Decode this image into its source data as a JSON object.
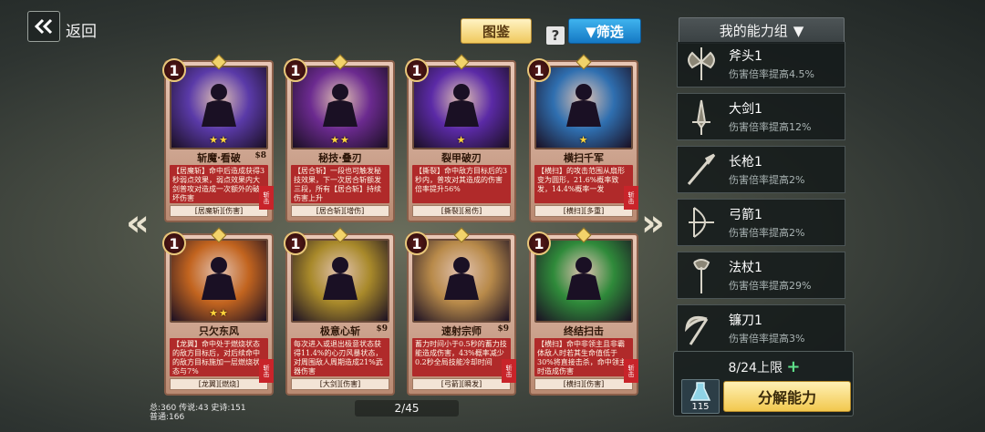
{
  "header": {
    "back_label": "返回",
    "tujian_label": "图鉴",
    "help_symbol": "?",
    "filter_label": "▼筛选",
    "panel_title": "我的能力组",
    "panel_arrow": "▼"
  },
  "nav": {
    "prev_arrow": "«",
    "next_arrow": "»"
  },
  "cards": [
    {
      "cost": "1",
      "stars": "★★",
      "name": "斩魔·看破",
      "price": "$8",
      "desc": "【居魔斩】命中后造成获得3秒弱点效果，弱点效果内大剑普攻对造成一次额外的破坏伤害",
      "tags": "[居魔斩][伤害]",
      "ribbon": "斩击",
      "art_color": "#5a3aa8"
    },
    {
      "cost": "1",
      "stars": "★★",
      "name": "秘技·叠刃",
      "price": "",
      "desc": "【居合斩】一段也可触发秘技效果，下一次居合斩额发三段，所有【居合斩】持续伤害上升",
      "tags": "[居合斩][增伤]",
      "ribbon": "",
      "art_color": "#6b2a8f"
    },
    {
      "cost": "1",
      "stars": "★",
      "name": "裂甲破刃",
      "price": "",
      "desc": "【撕裂】命中敌方目标后的3秒内，普攻对其造成的伤害倍率提升56%",
      "tags": "[撕裂][易伤]",
      "ribbon": "",
      "art_color": "#5b2aa6"
    },
    {
      "cost": "1",
      "stars": "★",
      "name": "横扫千军",
      "price": "",
      "desc": "【横扫】的攻击范围从扇形变为圆形，21.6%概率致发，14.4%概率一发",
      "tags": "[横扫][多重]",
      "ribbon": "斩击",
      "art_color": "#2f6fb0"
    },
    {
      "cost": "1",
      "stars": "★★",
      "name": "只欠东风",
      "price": "",
      "desc": "【龙翼】命中处于燃烧状态的敌方目标后，对后续命中的敌方目标施加一层燃烧状态与7%",
      "tags": "[龙翼][燃烧]",
      "ribbon": "斩击",
      "art_color": "#c2641f"
    },
    {
      "cost": "1",
      "stars": "",
      "name": "极意心斩",
      "price": "$9",
      "desc": "每次进入或退出极意状态获得11.4%的心刃风暴状态，对周围敌人周期造成21%武器伤害",
      "tags": "[大剑][伤害]",
      "ribbon": "",
      "art_color": "#a8892a"
    },
    {
      "cost": "1",
      "stars": "",
      "name": "速射宗师",
      "price": "$9",
      "desc": "蓄力时间小于0.5秒的蓄力技能造成伤害，43%概率减少0.2秒全局技能冷却时间",
      "tags": "[弓箭][瞬发]",
      "ribbon": "斩击",
      "art_color": "#b88a4a"
    },
    {
      "cost": "1",
      "stars": "",
      "name": "终结扫击",
      "price": "",
      "desc": "【横扫】命中非领主且非霸体敌人时若其生命值低于30%将直接击杀，命中领主时造成伤害",
      "tags": "[横扫][伤害]",
      "ribbon": "斩击",
      "art_color": "#2f8a3a"
    }
  ],
  "abilities": [
    {
      "name": "斧头1",
      "effect": "伤害倍率提高4.5%",
      "icon": "axe-icon"
    },
    {
      "name": "大剑1",
      "effect": "伤害倍率提高12%",
      "icon": "greatsword-icon"
    },
    {
      "name": "长枪1",
      "effect": "伤害倍率提高2%",
      "icon": "spear-icon"
    },
    {
      "name": "弓箭1",
      "effect": "伤害倍率提高2%",
      "icon": "bow-icon"
    },
    {
      "name": "法杖1",
      "effect": "伤害倍率提高29%",
      "icon": "staff-icon"
    },
    {
      "name": "镰刀1",
      "effect": "伤害倍率提高3%",
      "icon": "scythe-icon"
    }
  ],
  "limit": {
    "text": "8/24上限",
    "plus": "+",
    "potion_count": "115",
    "decompose_label": "分解能力"
  },
  "stats": {
    "line1": "总:360 传说:43 史诗:151",
    "line2": "普通:166"
  },
  "pager": {
    "text": "2/45"
  }
}
